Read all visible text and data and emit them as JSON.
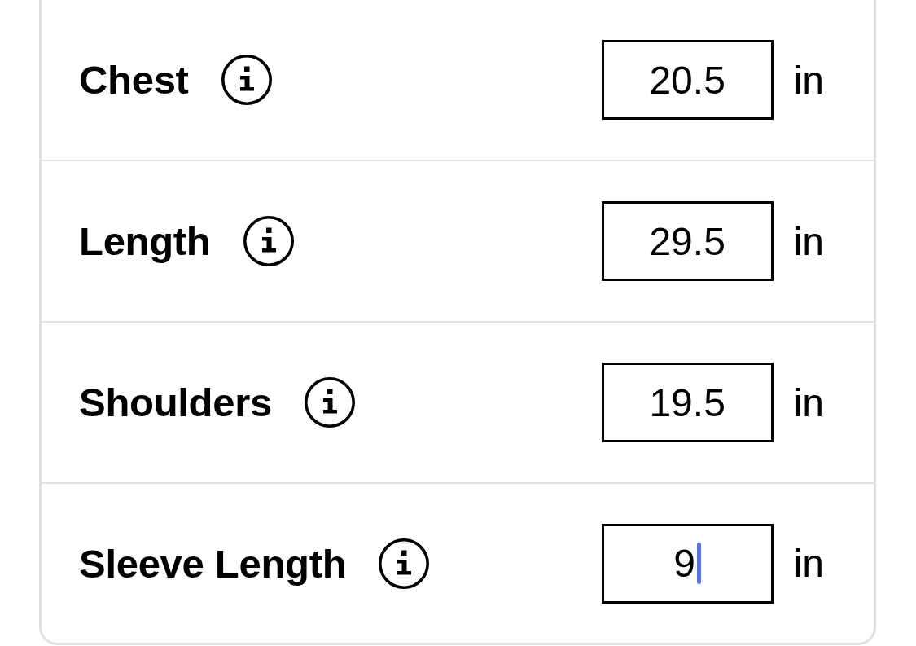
{
  "measurements": [
    {
      "label": "Chest",
      "value": "20.5",
      "unit": "in",
      "focused": false
    },
    {
      "label": "Length",
      "value": "29.5",
      "unit": "in",
      "focused": false
    },
    {
      "label": "Shoulders",
      "value": "19.5",
      "unit": "in",
      "focused": false
    },
    {
      "label": "Sleeve Length",
      "value": "9",
      "unit": "in",
      "focused": true
    }
  ]
}
